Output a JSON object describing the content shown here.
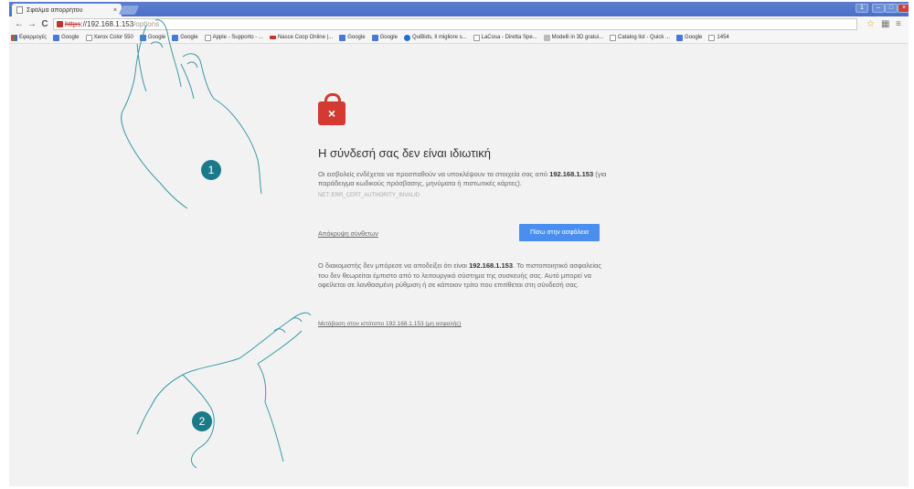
{
  "tab": {
    "title": "Σφάλμα απορρήτου",
    "close": "×"
  },
  "window_controls": [
    "1",
    "–",
    "□",
    "×"
  ],
  "toolbar": {
    "back": "←",
    "forward": "→",
    "reload": "C",
    "star": "☆",
    "ext": "▦",
    "menu": "≡"
  },
  "omnibox": {
    "scheme": "https",
    "separator": "://",
    "host": "192.168.1.153",
    "rest": "/options"
  },
  "bookmarks": [
    {
      "label": "Εφαρμογές",
      "icon": "apps"
    },
    {
      "label": "Google",
      "icon": "google"
    },
    {
      "label": "Xerox Color 550",
      "icon": "doc"
    },
    {
      "label": "Google",
      "icon": "google"
    },
    {
      "label": "Google",
      "icon": "google"
    },
    {
      "label": "Apple - Supporto - ...",
      "icon": "doc"
    },
    {
      "label": "Nasce Coop Online |...",
      "icon": "red"
    },
    {
      "label": "Google",
      "icon": "google"
    },
    {
      "label": "Google",
      "icon": "google"
    },
    {
      "label": "QuiBids, Il migliore s...",
      "icon": "blue"
    },
    {
      "label": "LaCosa - Diretta Spe...",
      "icon": "doc"
    },
    {
      "label": "Modelli in 3D gratui...",
      "icon": "grey"
    },
    {
      "label": "Catalog list - Quick ...",
      "icon": "doc"
    },
    {
      "label": "Google",
      "icon": "google"
    },
    {
      "label": "1454",
      "icon": "doc"
    }
  ],
  "page": {
    "lock_mark": "×",
    "title": "Η σύνδεσή σας δεν είναι ιδιωτική",
    "para1_a": "Οι εισβολείς ενδέχεται να προσπαθούν να υποκλέψουν τα στοιχεία σας από ",
    "para1_host": "192.168.1.153",
    "para1_b": " (για παράδειγμα κωδικούς πρόσβασης, μηνύματα ή πιστωτικές κάρτες).",
    "error_code": "NET::ERR_CERT_AUTHORITY_INVALID",
    "advanced_link": "Απόκρυψη σύνθετων",
    "back_button": "Πίσω στην ασφάλεια",
    "para2_a": "Ο διακομιστής δεν μπόρεσε να αποδείξει ότι είναι ",
    "para2_host": "192.168.1.153",
    "para2_b": ". Το πιστοποιητικό ασφαλείας του δεν θεωρείται έμπιστο από το λειτουργικό σύστημα της συσκευής σας. Αυτό μπορεί να οφείλεται σε λανθασμένη ρύθμιση ή σε κάποιον τρίτο που επιτίθεται στη σύνδεσή σας.",
    "proceed_link": "Μετάβαση στον ιστότοπο 192.168.1.153 (μη ασφαλής)"
  },
  "annotations": {
    "step1": "1",
    "step2": "2"
  },
  "colors": {
    "accent": "#4a8ff0",
    "danger": "#d33b32",
    "badge": "#1a7a8a"
  }
}
